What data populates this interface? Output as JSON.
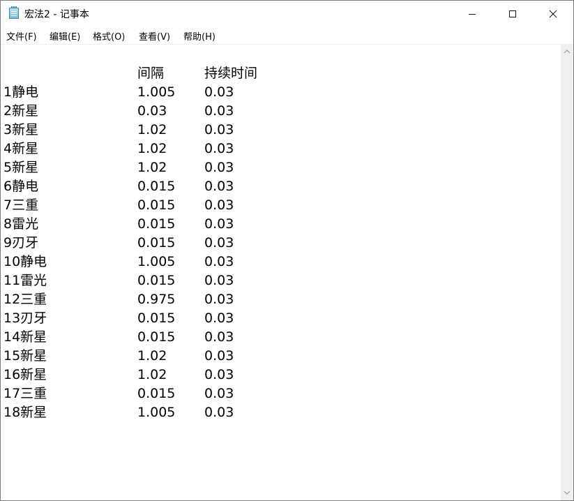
{
  "window": {
    "title": "宏法2 - 记事本",
    "icon": "notepad-icon"
  },
  "titlebar_buttons": {
    "minimize": "minimize-icon",
    "maximize": "maximize-icon",
    "close": "close-icon"
  },
  "menu": [
    {
      "label": "文件(F)"
    },
    {
      "label": "编辑(E)"
    },
    {
      "label": "格式(O)"
    },
    {
      "label": "查看(V)"
    },
    {
      "label": "帮助(H)"
    }
  ],
  "document": {
    "header": {
      "name": "",
      "interval": "间隔",
      "duration": "持续时间"
    },
    "rows": [
      {
        "name": "1静电",
        "interval": "1.005",
        "duration": "0.03"
      },
      {
        "name": "2新星",
        "interval": "0.03",
        "duration": "0.03"
      },
      {
        "name": "3新星",
        "interval": "1.02",
        "duration": "0.03"
      },
      {
        "name": "4新星",
        "interval": "1.02",
        "duration": "0.03"
      },
      {
        "name": "5新星",
        "interval": "1.02",
        "duration": "0.03"
      },
      {
        "name": "6静电",
        "interval": "0.015",
        "duration": "0.03"
      },
      {
        "name": "7三重",
        "interval": "0.015",
        "duration": "0.03"
      },
      {
        "name": "8雷光",
        "interval": "0.015",
        "duration": "0.03"
      },
      {
        "name": "9刃牙",
        "interval": "0.015",
        "duration": "0.03"
      },
      {
        "name": "10静电",
        "interval": "1.005",
        "duration": "0.03"
      },
      {
        "name": "11雷光",
        "interval": "0.015",
        "duration": "0.03"
      },
      {
        "name": "12三重",
        "interval": "0.975",
        "duration": "0.03"
      },
      {
        "name": "13刃牙",
        "interval": "0.015",
        "duration": "0.03"
      },
      {
        "name": "14新星",
        "interval": "0.015",
        "duration": "0.03"
      },
      {
        "name": "15新星",
        "interval": "1.02",
        "duration": "0.03"
      },
      {
        "name": "16新星",
        "interval": "1.02",
        "duration": "0.03"
      },
      {
        "name": "17三重",
        "interval": "0.015",
        "duration": "0.03"
      },
      {
        "name": "18新星",
        "interval": "1.005",
        "duration": "0.03"
      }
    ]
  },
  "scrollbar": {
    "up": "scroll-up-arrow-icon",
    "down": "scroll-down-arrow-icon"
  }
}
